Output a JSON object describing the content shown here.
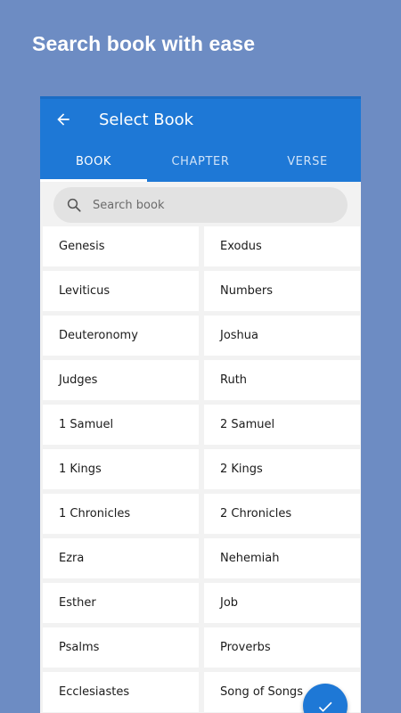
{
  "promo": {
    "title": "Search book with ease"
  },
  "appbar": {
    "title": "Select Book",
    "back_icon": "arrow-left-icon"
  },
  "tabs": [
    {
      "label": "BOOK",
      "active": true
    },
    {
      "label": "CHAPTER",
      "active": false
    },
    {
      "label": "VERSE",
      "active": false
    }
  ],
  "search": {
    "placeholder": "Search book",
    "icon": "search-icon"
  },
  "books": [
    "Genesis",
    "Exodus",
    "Leviticus",
    "Numbers",
    "Deuteronomy",
    "Joshua",
    "Judges",
    "Ruth",
    "1 Samuel",
    "2 Samuel",
    "1 Kings",
    "2 Kings",
    "1 Chronicles",
    "2 Chronicles",
    "Ezra",
    "Nehemiah",
    "Esther",
    "Job",
    "Psalms",
    "Proverbs",
    "Ecclesiastes",
    "Song of Songs"
  ],
  "fab": {
    "icon": "check-icon"
  },
  "colors": {
    "background": "#6d8cc3",
    "primary": "#1e78d6",
    "surface": "#ffffff"
  }
}
